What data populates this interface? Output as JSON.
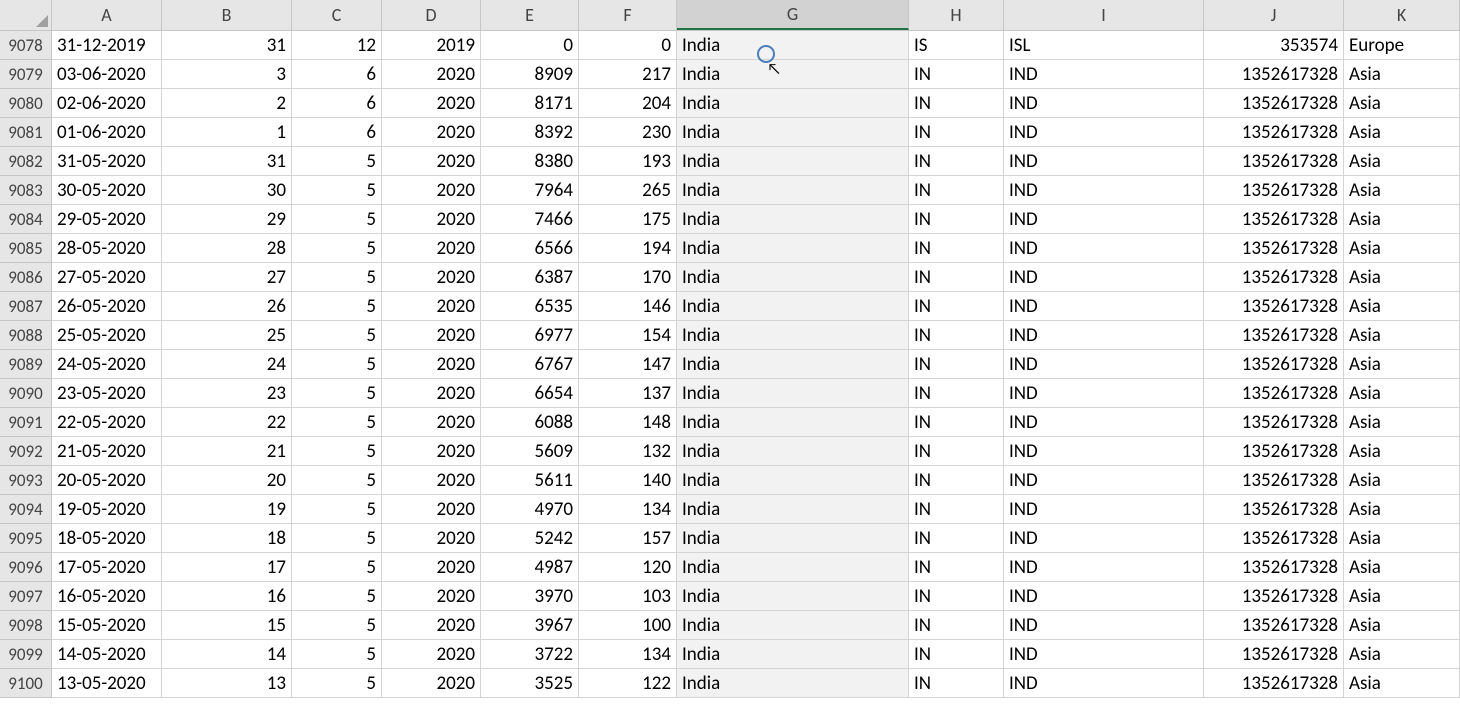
{
  "columns": [
    {
      "letter": "A",
      "cls": "cA",
      "selected": false
    },
    {
      "letter": "B",
      "cls": "cB",
      "selected": false
    },
    {
      "letter": "C",
      "cls": "cC",
      "selected": false
    },
    {
      "letter": "D",
      "cls": "cD",
      "selected": false
    },
    {
      "letter": "E",
      "cls": "cE",
      "selected": false
    },
    {
      "letter": "F",
      "cls": "cF",
      "selected": false
    },
    {
      "letter": "G",
      "cls": "cG",
      "selected": true
    },
    {
      "letter": "H",
      "cls": "cH",
      "selected": false
    },
    {
      "letter": "I",
      "cls": "cI",
      "selected": false
    },
    {
      "letter": "J",
      "cls": "cJ",
      "selected": false
    },
    {
      "letter": "K",
      "cls": "cK",
      "selected": false
    }
  ],
  "col_align": [
    "txt",
    "num",
    "num",
    "num",
    "num",
    "num",
    "txt",
    "txt",
    "txt",
    "num",
    "txt"
  ],
  "rows": [
    {
      "n": 9078,
      "c": [
        "31-12-2019",
        "31",
        "12",
        "2019",
        "0",
        "0",
        "India",
        "IS",
        "ISL",
        "353574",
        "Europe"
      ]
    },
    {
      "n": 9079,
      "c": [
        "03-06-2020",
        "3",
        "6",
        "2020",
        "8909",
        "217",
        "India",
        "IN",
        "IND",
        "1352617328",
        "Asia"
      ]
    },
    {
      "n": 9080,
      "c": [
        "02-06-2020",
        "2",
        "6",
        "2020",
        "8171",
        "204",
        "India",
        "IN",
        "IND",
        "1352617328",
        "Asia"
      ]
    },
    {
      "n": 9081,
      "c": [
        "01-06-2020",
        "1",
        "6",
        "2020",
        "8392",
        "230",
        "India",
        "IN",
        "IND",
        "1352617328",
        "Asia"
      ]
    },
    {
      "n": 9082,
      "c": [
        "31-05-2020",
        "31",
        "5",
        "2020",
        "8380",
        "193",
        "India",
        "IN",
        "IND",
        "1352617328",
        "Asia"
      ]
    },
    {
      "n": 9083,
      "c": [
        "30-05-2020",
        "30",
        "5",
        "2020",
        "7964",
        "265",
        "India",
        "IN",
        "IND",
        "1352617328",
        "Asia"
      ]
    },
    {
      "n": 9084,
      "c": [
        "29-05-2020",
        "29",
        "5",
        "2020",
        "7466",
        "175",
        "India",
        "IN",
        "IND",
        "1352617328",
        "Asia"
      ]
    },
    {
      "n": 9085,
      "c": [
        "28-05-2020",
        "28",
        "5",
        "2020",
        "6566",
        "194",
        "India",
        "IN",
        "IND",
        "1352617328",
        "Asia"
      ]
    },
    {
      "n": 9086,
      "c": [
        "27-05-2020",
        "27",
        "5",
        "2020",
        "6387",
        "170",
        "India",
        "IN",
        "IND",
        "1352617328",
        "Asia"
      ]
    },
    {
      "n": 9087,
      "c": [
        "26-05-2020",
        "26",
        "5",
        "2020",
        "6535",
        "146",
        "India",
        "IN",
        "IND",
        "1352617328",
        "Asia"
      ]
    },
    {
      "n": 9088,
      "c": [
        "25-05-2020",
        "25",
        "5",
        "2020",
        "6977",
        "154",
        "India",
        "IN",
        "IND",
        "1352617328",
        "Asia"
      ]
    },
    {
      "n": 9089,
      "c": [
        "24-05-2020",
        "24",
        "5",
        "2020",
        "6767",
        "147",
        "India",
        "IN",
        "IND",
        "1352617328",
        "Asia"
      ]
    },
    {
      "n": 9090,
      "c": [
        "23-05-2020",
        "23",
        "5",
        "2020",
        "6654",
        "137",
        "India",
        "IN",
        "IND",
        "1352617328",
        "Asia"
      ]
    },
    {
      "n": 9091,
      "c": [
        "22-05-2020",
        "22",
        "5",
        "2020",
        "6088",
        "148",
        "India",
        "IN",
        "IND",
        "1352617328",
        "Asia"
      ]
    },
    {
      "n": 9092,
      "c": [
        "21-05-2020",
        "21",
        "5",
        "2020",
        "5609",
        "132",
        "India",
        "IN",
        "IND",
        "1352617328",
        "Asia"
      ]
    },
    {
      "n": 9093,
      "c": [
        "20-05-2020",
        "20",
        "5",
        "2020",
        "5611",
        "140",
        "India",
        "IN",
        "IND",
        "1352617328",
        "Asia"
      ]
    },
    {
      "n": 9094,
      "c": [
        "19-05-2020",
        "19",
        "5",
        "2020",
        "4970",
        "134",
        "India",
        "IN",
        "IND",
        "1352617328",
        "Asia"
      ]
    },
    {
      "n": 9095,
      "c": [
        "18-05-2020",
        "18",
        "5",
        "2020",
        "5242",
        "157",
        "India",
        "IN",
        "IND",
        "1352617328",
        "Asia"
      ]
    },
    {
      "n": 9096,
      "c": [
        "17-05-2020",
        "17",
        "5",
        "2020",
        "4987",
        "120",
        "India",
        "IN",
        "IND",
        "1352617328",
        "Asia"
      ]
    },
    {
      "n": 9097,
      "c": [
        "16-05-2020",
        "16",
        "5",
        "2020",
        "3970",
        "103",
        "India",
        "IN",
        "IND",
        "1352617328",
        "Asia"
      ]
    },
    {
      "n": 9098,
      "c": [
        "15-05-2020",
        "15",
        "5",
        "2020",
        "3967",
        "100",
        "India",
        "IN",
        "IND",
        "1352617328",
        "Asia"
      ]
    },
    {
      "n": 9099,
      "c": [
        "14-05-2020",
        "14",
        "5",
        "2020",
        "3722",
        "134",
        "India",
        "IN",
        "IND",
        "1352617328",
        "Asia"
      ]
    },
    {
      "n": 9100,
      "c": [
        "13-05-2020",
        "13",
        "5",
        "2020",
        "3525",
        "122",
        "India",
        "IN",
        "IND",
        "1352617328",
        "Asia"
      ]
    }
  ],
  "selected_column_index": 6
}
